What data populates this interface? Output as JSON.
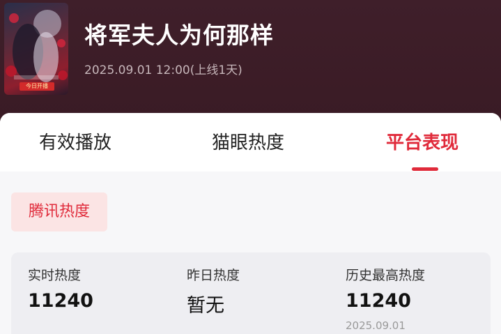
{
  "header": {
    "title": "将军夫人为何那样",
    "subtitle": "2025.09.01 12:00(上线1天)",
    "poster": {
      "tag": "今日开播"
    }
  },
  "tabs": [
    {
      "label": "有效播放",
      "active": false
    },
    {
      "label": "猫眼热度",
      "active": false
    },
    {
      "label": "平台表现",
      "active": true
    }
  ],
  "platform_chip": {
    "label": "腾讯热度"
  },
  "stats": [
    {
      "label": "实时热度",
      "value": "11240"
    },
    {
      "label": "昨日热度",
      "value": "暂无"
    },
    {
      "label": "历史最高热度",
      "value": "11240",
      "date": "2025.09.01"
    }
  ],
  "colors": {
    "header_bg": "#3d1e28",
    "accent": "#e02a3a",
    "chip_bg": "#fbe4e4",
    "card_bg": "#f7f7f9",
    "stats_bg": "#eeeef2"
  }
}
